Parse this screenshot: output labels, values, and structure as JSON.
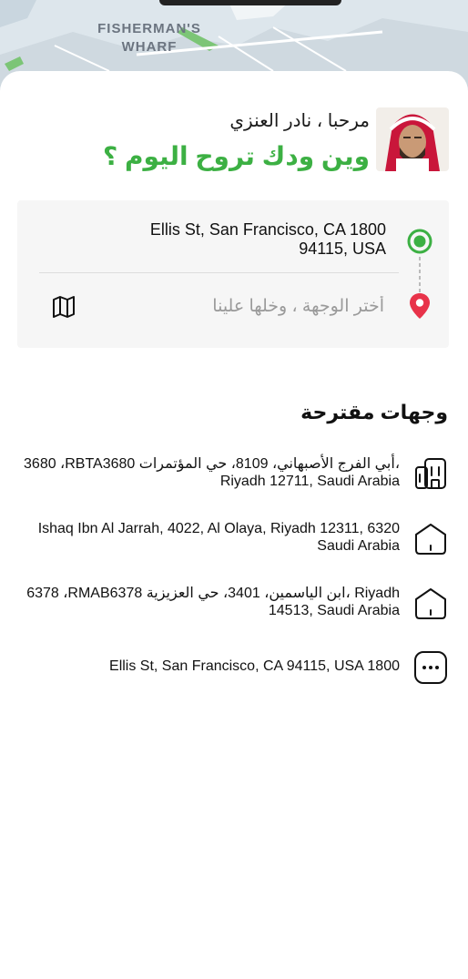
{
  "map": {
    "label_line1": "FISHERMAN'S",
    "label_line2": "WHARF"
  },
  "greeting": {
    "hello": "مرحبا ، نادر العنزي",
    "headline": "وين ودك تروح اليوم ؟"
  },
  "route": {
    "origin_line1": "Ellis St, San Francisco, CA 1800",
    "origin_line2": "94115, USA",
    "destination_placeholder": "أختر الوجهة ، وخلها علينا",
    "origin_color": "#3cb043",
    "destination_color": "#e8334a"
  },
  "suggestions": {
    "title": "وجهات مقترحة",
    "items": [
      {
        "icon": "building-icon",
        "line1": "3680 ،RBTA3680 أبي الفرج الأصبهاني، 8109، حي المؤتمرات،",
        "line2": "Riyadh 12711, Saudi Arabia"
      },
      {
        "icon": "home-icon",
        "line1": "Ishaq Ibn Al Jarrah, 4022, Al Olaya, Riyadh 12311, 6320",
        "line2": "Saudi Arabia"
      },
      {
        "icon": "home-icon",
        "line1": "6378 ،RMAB6378 ابن الياسمين، 3401، حي العزيزية، Riyadh",
        "line2": "14513, Saudi Arabia"
      },
      {
        "icon": "more-icon",
        "line1": "Ellis St, San Francisco, CA 94115, USA 1800",
        "line2": ""
      }
    ]
  }
}
